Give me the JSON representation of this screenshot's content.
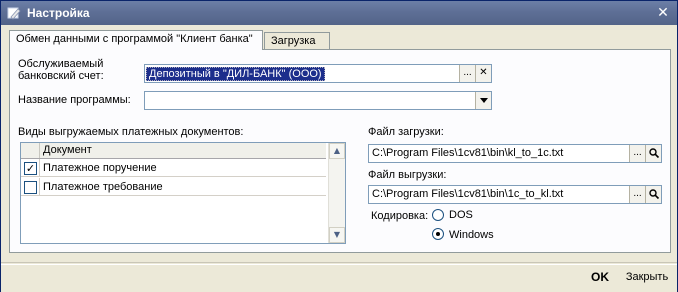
{
  "window": {
    "title": "Настройка",
    "close_glyph": "✕",
    "icon": "settings-window-icon"
  },
  "tabs": [
    {
      "label": "Обмен данными с программой \"Клиент банка\"",
      "active": true
    },
    {
      "label": "Загрузка",
      "active": false
    }
  ],
  "form": {
    "bank_account_label_line1": "Обслуживаемый",
    "bank_account_label_line2": "банковский счет:",
    "bank_account_value": "Депозитный в \"ДИЛ-БАНК\" (ООО)",
    "program_name_label": "Название программы:",
    "program_name_value": "",
    "select_button_glyph": "...",
    "clear_button_glyph": "✕"
  },
  "documents": {
    "section_label": "Виды выгружаемых платежных документов:",
    "column_header": "Документ",
    "rows": [
      {
        "checked": true,
        "label": "Платежное поручение"
      },
      {
        "checked": false,
        "label": "Платежное требование"
      }
    ],
    "check_glyph": "✓",
    "scroll_up_glyph": "▲",
    "scroll_down_glyph": "▼"
  },
  "files": {
    "import_label": "Файл загрузки:",
    "import_path": "C:\\Program Files\\1cv81\\bin\\kl_to_1c.txt",
    "export_label": "Файл выгрузки:",
    "export_path": "C:\\Program Files\\1cv81\\bin\\1c_to_kl.txt",
    "browse_glyph": "...",
    "search_icon": "magnifier-icon"
  },
  "encoding": {
    "label": "Кодировка:",
    "options": [
      {
        "label": "DOS",
        "selected": false
      },
      {
        "label": "Windows",
        "selected": true
      }
    ]
  },
  "footer": {
    "ok_label": "OK",
    "close_label": "Закрыть"
  },
  "colors": {
    "title_bar": "#5E6F96",
    "selection": "#1C2E8C",
    "panel_bg": "#FCFCFE",
    "window_bg": "#ECE9D8"
  }
}
